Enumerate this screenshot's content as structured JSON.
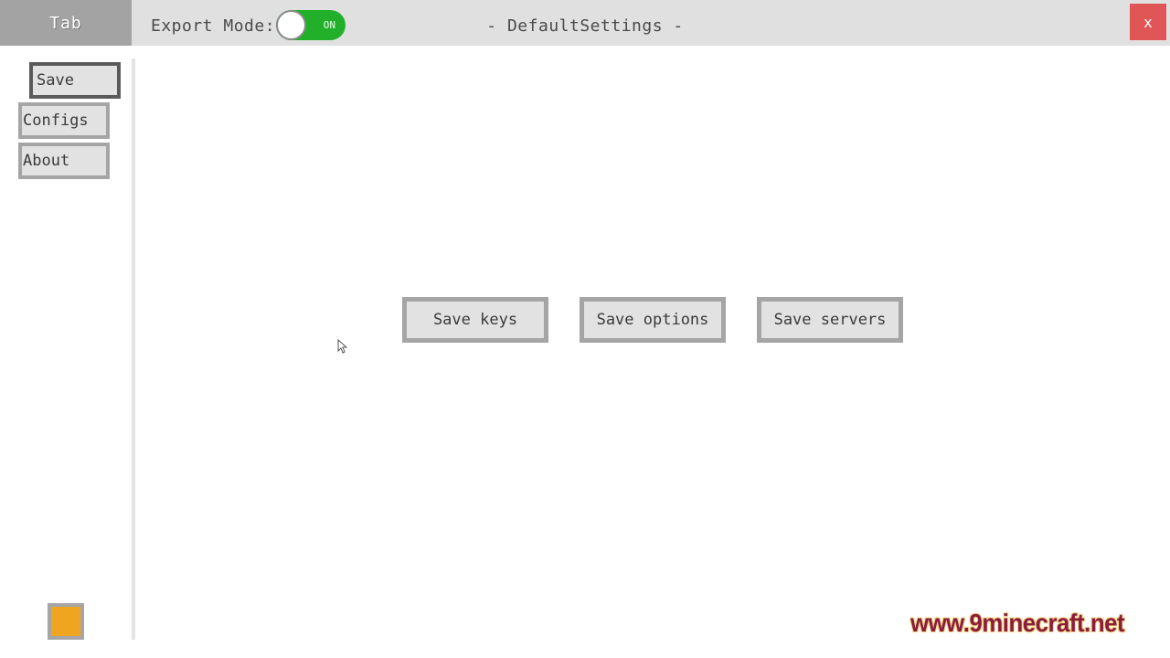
{
  "header": {
    "tab_label": "Tab",
    "export_mode_label": "Export Mode:",
    "export_mode_toggle": {
      "state": "ON",
      "enabled": true
    },
    "title": "- DefaultSettings -",
    "close_label": "x"
  },
  "sidebar": {
    "items": [
      {
        "label": "Save",
        "active": true
      },
      {
        "label": "Configs",
        "active": false
      },
      {
        "label": "About",
        "active": false
      }
    ],
    "color_swatch": "#f0a520"
  },
  "main": {
    "buttons": [
      {
        "label": "Save keys"
      },
      {
        "label": "Save options"
      },
      {
        "label": "Save servers"
      }
    ]
  },
  "watermark": "www.9minecraft.net",
  "colors": {
    "toggle_on": "#22b02a",
    "close": "#e05555",
    "accent_swatch": "#f0a520"
  }
}
